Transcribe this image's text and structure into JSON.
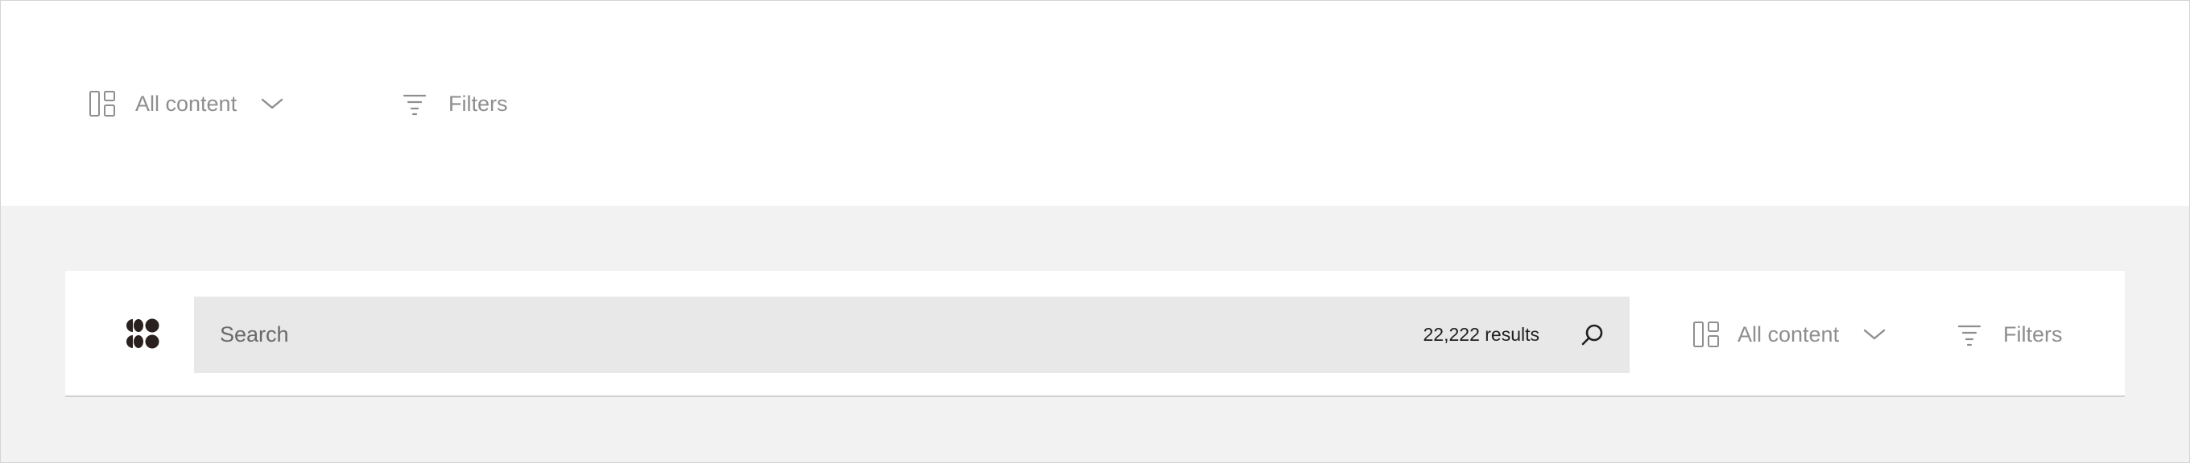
{
  "top_bar": {
    "content_selector": {
      "label": "All content",
      "icon": "layout-icon"
    },
    "filters": {
      "label": "Filters",
      "icon": "filter-icon"
    }
  },
  "toolbar": {
    "logo": {
      "icon": "logo-icon"
    },
    "search": {
      "placeholder": "Search",
      "value": "",
      "results": "22,222 results",
      "icon": "search-icon"
    },
    "content_selector": {
      "label": "All content",
      "icon": "layout-icon"
    },
    "filters": {
      "label": "Filters",
      "icon": "filter-icon"
    }
  },
  "colors": {
    "muted_text": "#8e8e8e",
    "search_bg": "#e8e8e8",
    "page_bg": "#f2f2f2",
    "logo": "#2a2020"
  }
}
